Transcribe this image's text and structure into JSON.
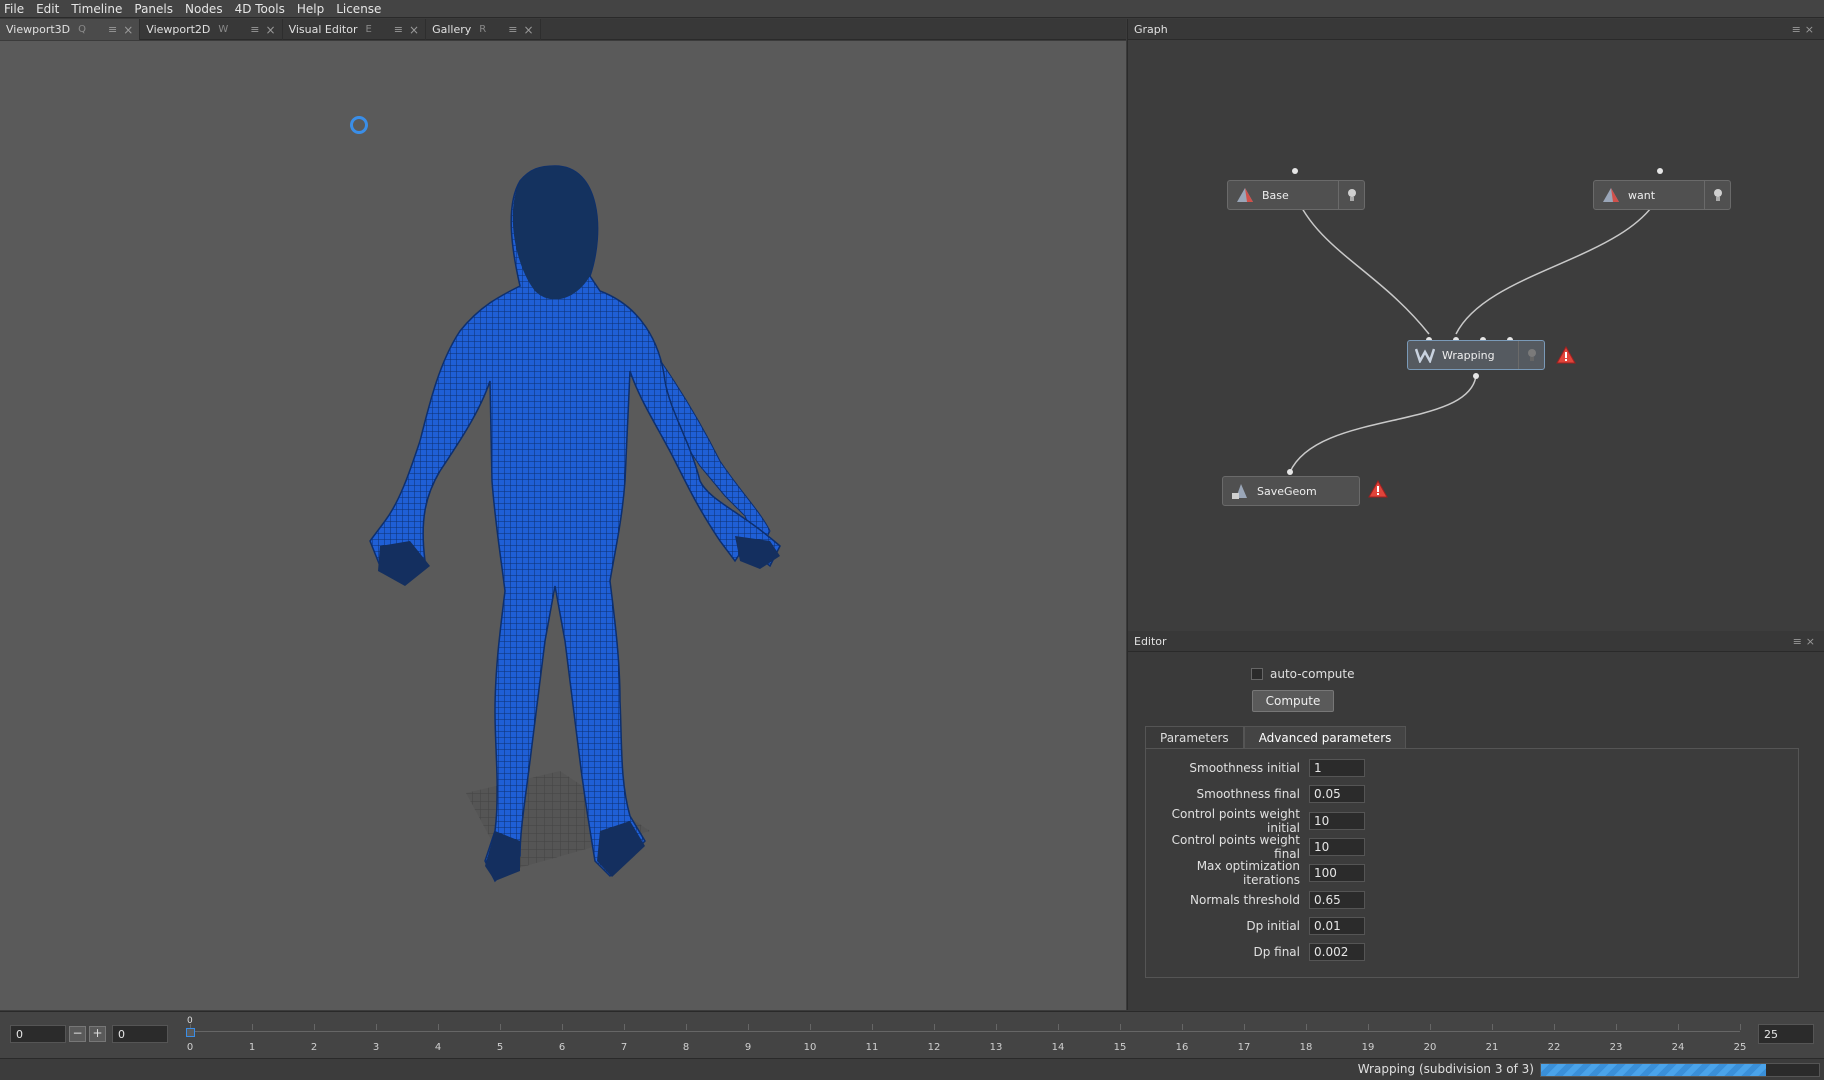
{
  "menu": [
    "File",
    "Edit",
    "Timeline",
    "Panels",
    "Nodes",
    "4D Tools",
    "Help",
    "License"
  ],
  "left_tabs": [
    {
      "label": "Viewport3D",
      "hotkey": "Q"
    },
    {
      "label": "Viewport2D",
      "hotkey": "W"
    },
    {
      "label": "Visual Editor",
      "hotkey": "E"
    },
    {
      "label": "Gallery",
      "hotkey": "R"
    }
  ],
  "tab_icons": {
    "menu": "≡",
    "close": "×"
  },
  "graph": {
    "title": "Graph",
    "nodes": {
      "base": "Base",
      "want": "want",
      "wrapping": "Wrapping",
      "savegeom": "SaveGeom"
    }
  },
  "editor": {
    "title": "Editor",
    "auto_compute_label": "auto-compute",
    "compute_label": "Compute",
    "tabs": [
      "Parameters",
      "Advanced parameters"
    ],
    "active_tab": "Advanced parameters",
    "params": [
      {
        "label": "Smoothness initial",
        "value": "1"
      },
      {
        "label": "Smoothness final",
        "value": "0.05"
      },
      {
        "label": "Control points weight initial",
        "value": "10"
      },
      {
        "label": "Control points weight final",
        "value": "10"
      },
      {
        "label": "Max optimization iterations",
        "value": "100"
      },
      {
        "label": "Normals threshold",
        "value": "0.65"
      },
      {
        "label": "Dp initial",
        "value": "0.01"
      },
      {
        "label": "Dp final",
        "value": "0.002"
      }
    ]
  },
  "timeline": {
    "start_value": "0",
    "current_value": "0",
    "minus": "−",
    "plus": "+",
    "playhead": "0",
    "ticks": [
      "0",
      "1",
      "2",
      "3",
      "4",
      "5",
      "6",
      "7",
      "8",
      "9",
      "10",
      "11",
      "12",
      "13",
      "14",
      "15",
      "16",
      "17",
      "18",
      "19",
      "20",
      "21",
      "22",
      "23",
      "24",
      "25"
    ],
    "end_value": "25"
  },
  "status": {
    "text": "Wrapping (subdivision 3 of 3)",
    "progress": 0.81
  },
  "colors": {
    "mesh": "#1f5fd6",
    "accent": "#3a8ee8",
    "warning": "#e0443a"
  }
}
